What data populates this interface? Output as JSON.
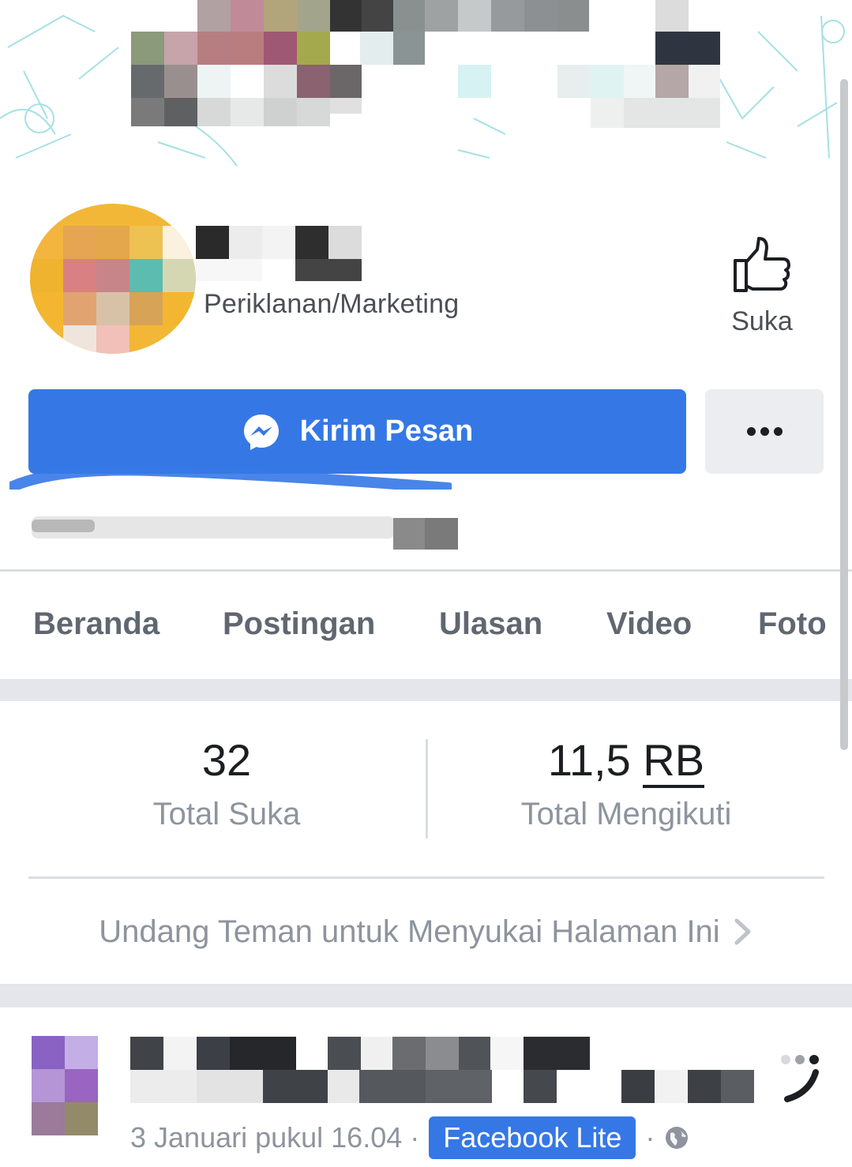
{
  "page": {
    "category": "Periklanan/Marketing",
    "like_label": "Suka",
    "message_button_label": "Kirim Pesan",
    "more_button_label": "•••"
  },
  "tabs": [
    {
      "label": "Beranda"
    },
    {
      "label": "Postingan"
    },
    {
      "label": "Ulasan"
    },
    {
      "label": "Video"
    },
    {
      "label": "Foto"
    }
  ],
  "stats": {
    "likes_value": "32",
    "likes_label": "Total Suka",
    "followers_value_num": "11,5 ",
    "followers_value_unit": "RB",
    "followers_label": "Total Mengikuti"
  },
  "invite": {
    "label": "Undang Teman untuk Menyukai Halaman Ini"
  },
  "post": {
    "date": "3 Januari pukul 16.04",
    "separator": "·",
    "app_label": "Facebook Lite",
    "separator2": "·"
  },
  "colors": {
    "accent": "#3578e5",
    "secondary_button": "#ebedf0",
    "muted_text": "#8d949e",
    "tab_text": "#606770"
  },
  "icons": {
    "like": "thumbs-up-icon",
    "messenger": "messenger-icon",
    "more": "more-dots-icon",
    "chevron": "chevron-right-icon",
    "globe": "globe-icon"
  }
}
